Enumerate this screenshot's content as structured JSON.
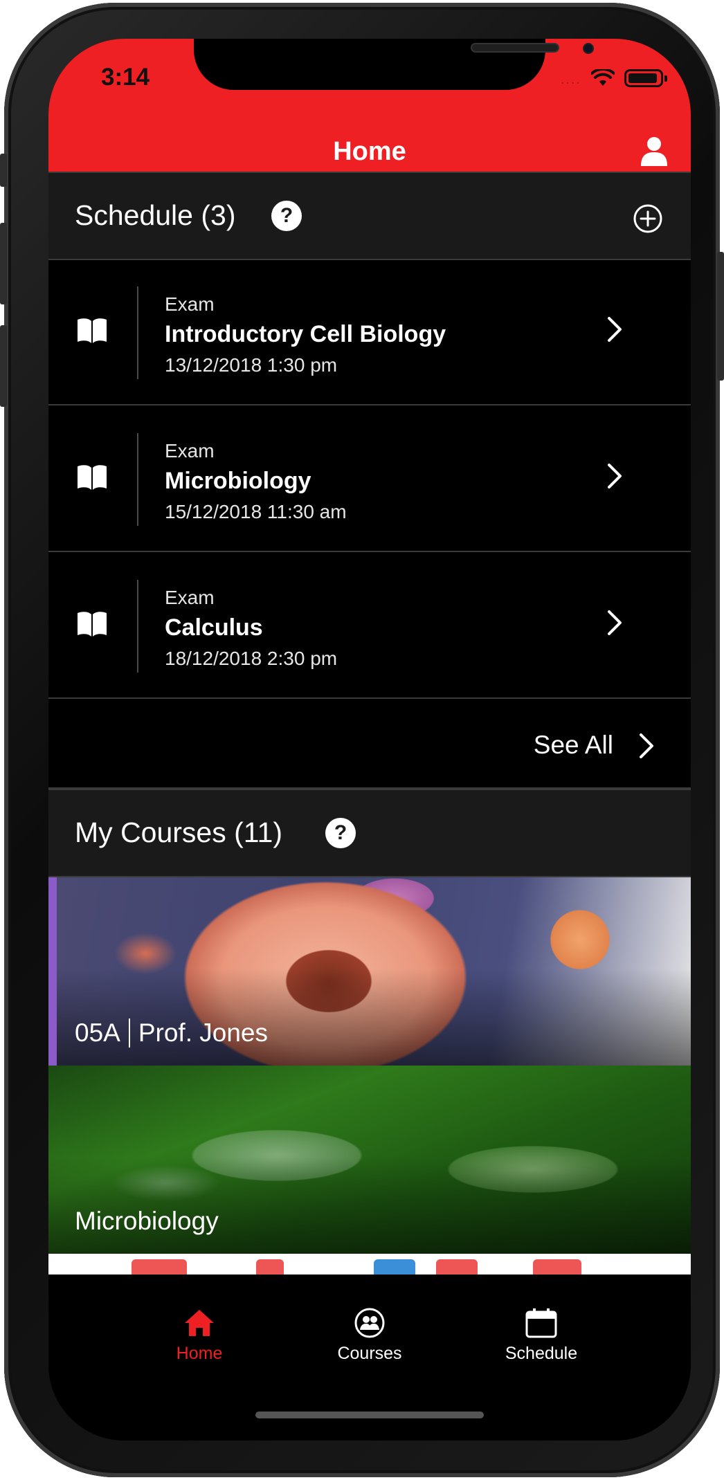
{
  "status_bar": {
    "time": "3:14",
    "signal": "...."
  },
  "header": {
    "title": "Home"
  },
  "schedule": {
    "title": "Schedule (3)",
    "help_icon": "?",
    "items": [
      {
        "type": "Exam",
        "name": "Introductory Cell Biology",
        "date": "13/12/2018 1:30 pm"
      },
      {
        "type": "Exam",
        "name": "Microbiology",
        "date": "15/12/2018 11:30 am"
      },
      {
        "type": "Exam",
        "name": "Calculus",
        "date": "18/12/2018 2:30 pm"
      }
    ],
    "see_all_label": "See All"
  },
  "courses": {
    "title": "My Courses (11)",
    "help_icon": "?",
    "items": [
      {
        "code": "05A",
        "instructor": "Prof. Jones",
        "accent_color": "#8b5cc7"
      },
      {
        "name": "Microbiology"
      }
    ]
  },
  "tabs": [
    {
      "label": "Home",
      "icon": "home-icon",
      "active": true
    },
    {
      "label": "Courses",
      "icon": "people-icon",
      "active": false
    },
    {
      "label": "Schedule",
      "icon": "calendar-icon",
      "active": false
    }
  ],
  "colors": {
    "brand_red": "#ee2023",
    "section_bg": "#1a1a1a",
    "background": "#000000"
  }
}
